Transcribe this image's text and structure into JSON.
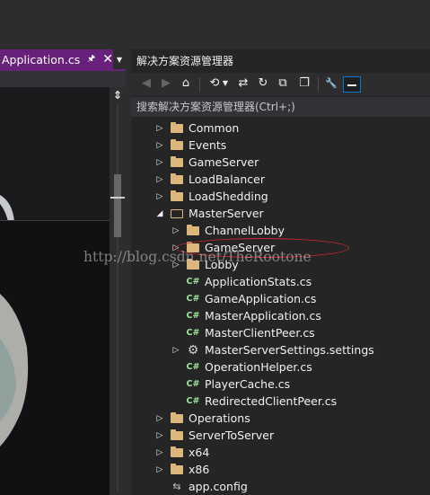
{
  "editor": {
    "tab_label": "Application.cs",
    "pin_glyph": "🖈",
    "close_glyph": "✕",
    "dropdown_glyph": "▼",
    "split_glyph": "⇕"
  },
  "solution_explorer": {
    "title": "解决方案资源管理器",
    "search_placeholder": "搜索解决方案资源管理器(Ctrl+;)",
    "toolbar": [
      {
        "name": "back-icon",
        "glyph": "◀",
        "disabled": true
      },
      {
        "name": "forward-icon",
        "glyph": "▶",
        "disabled": true
      },
      {
        "name": "home-icon",
        "glyph": "⌂",
        "disabled": false
      },
      {
        "name": "history-icon",
        "glyph": "⟲",
        "disabled": false
      },
      {
        "name": "sync-icon",
        "glyph": "⇄",
        "disabled": false
      },
      {
        "name": "refresh-icon",
        "glyph": "↻",
        "disabled": false
      },
      {
        "name": "collapse-all-icon",
        "glyph": "⧉",
        "disabled": false
      },
      {
        "name": "show-all-files-icon",
        "glyph": "❐",
        "disabled": false
      },
      {
        "name": "properties-wrench-icon",
        "glyph": "🔧",
        "disabled": false
      }
    ],
    "tree": [
      {
        "label": "Common",
        "type": "folder",
        "level": 0,
        "expander": "collapsed"
      },
      {
        "label": "Events",
        "type": "folder",
        "level": 0,
        "expander": "collapsed"
      },
      {
        "label": "GameServer",
        "type": "folder",
        "level": 0,
        "expander": "collapsed"
      },
      {
        "label": "LoadBalancer",
        "type": "folder",
        "level": 0,
        "expander": "collapsed"
      },
      {
        "label": "LoadShedding",
        "type": "folder",
        "level": 0,
        "expander": "collapsed"
      },
      {
        "label": "MasterServer",
        "type": "folder-open",
        "level": 0,
        "expander": "expanded"
      },
      {
        "label": "ChannelLobby",
        "type": "folder",
        "level": 1,
        "expander": "collapsed"
      },
      {
        "label": "GameServer",
        "type": "folder",
        "level": 1,
        "expander": "collapsed"
      },
      {
        "label": "Lobby",
        "type": "folder",
        "level": 1,
        "expander": "collapsed"
      },
      {
        "label": "ApplicationStats.cs",
        "type": "cs",
        "level": 1,
        "expander": "none"
      },
      {
        "label": "GameApplication.cs",
        "type": "cs",
        "level": 1,
        "expander": "none"
      },
      {
        "label": "MasterApplication.cs",
        "type": "cs",
        "level": 1,
        "expander": "none"
      },
      {
        "label": "MasterClientPeer.cs",
        "type": "cs",
        "level": 1,
        "expander": "none"
      },
      {
        "label": "MasterServerSettings.settings",
        "type": "settings",
        "level": 1,
        "expander": "collapsed"
      },
      {
        "label": "OperationHelper.cs",
        "type": "cs",
        "level": 1,
        "expander": "none"
      },
      {
        "label": "PlayerCache.cs",
        "type": "cs",
        "level": 1,
        "expander": "none"
      },
      {
        "label": "RedirectedClientPeer.cs",
        "type": "cs",
        "level": 1,
        "expander": "none"
      },
      {
        "label": "Operations",
        "type": "folder",
        "level": 0,
        "expander": "collapsed"
      },
      {
        "label": "ServerToServer",
        "type": "folder",
        "level": 0,
        "expander": "collapsed"
      },
      {
        "label": "x64",
        "type": "folder",
        "level": 0,
        "expander": "collapsed"
      },
      {
        "label": "x86",
        "type": "folder",
        "level": 0,
        "expander": "collapsed"
      },
      {
        "label": "app.config",
        "type": "config",
        "level": 0,
        "expander": "none"
      }
    ],
    "glyphs": {
      "collapsed": "▷",
      "expanded": "◢",
      "cs": "C#",
      "settings": "⚙",
      "config": "⇆"
    }
  },
  "watermark": "http://blog.csdn.net/TheRootone",
  "colors": {
    "tab_accent": "#68217a",
    "folder": "#dcb67a",
    "cs_icon": "#9ee39e",
    "highlight": "#c5282f",
    "selected_toolbar": "#007acc"
  }
}
